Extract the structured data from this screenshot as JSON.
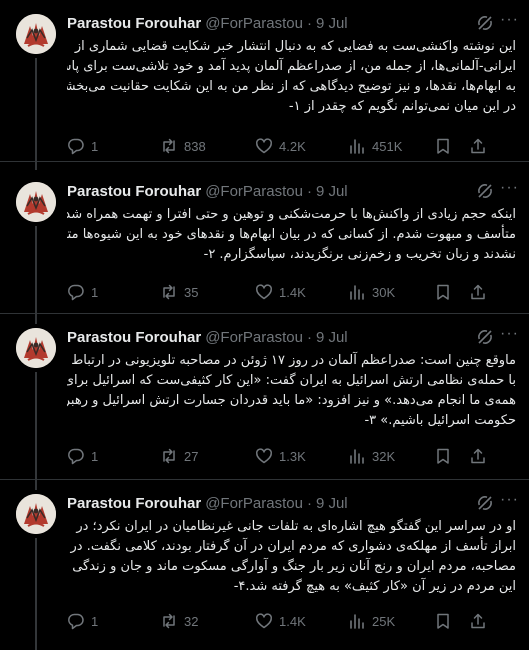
{
  "tweets": [
    {
      "author": "Parastou Forouhar",
      "handle": "@ForParastou",
      "separator": "·",
      "time": "9 Jul",
      "lines": [
        "این نوشته واکنشی‌ست به فضایی که به دنبال انتشار خبر شکایت قضایی شماری از",
        "ایرانی-آلمانی‌ها، از جمله من، از صدراعظم آلمان پدید آمد و خود تلاشی‌ست برای پاسخ",
        "به ابهام‌ها، نقدها، و نیز توضیح دیدگاهی که از نظر من به این شکایت حقانیت می‌بخشد.",
        "در این میان نمی‌توانم نگویم که چقدر از ۱-"
      ],
      "replies": "1",
      "reposts": "838",
      "likes": "4.2K",
      "views": "451K"
    },
    {
      "author": "Parastou Forouhar",
      "handle": "@ForParastou",
      "separator": "·",
      "time": "9 Jul",
      "lines": [
        "اینکه حجم زیادی از واکنش‌ها با حرمت‌شکنی و توهین و حتی افترا و تهمت همراه شده،",
        "متأسف و مبهوت شدم. از کسانی که در بیان ابهام‌ها و نقدهای خود به این شیوه‌ها متوسل",
        "نشدند و زبان تخریب و زخم‌زنی برنگزیدند، سپاسگزارم. ۲-"
      ],
      "replies": "1",
      "reposts": "35",
      "likes": "1.4K",
      "views": "30K"
    },
    {
      "author": "Parastou Forouhar",
      "handle": "@ForParastou",
      "separator": "·",
      "time": "9 Jul",
      "lines": [
        "ماوقع چنین است: صدراعظم آلمان در روز ۱۷ ژوئن در مصاحبه تلویزیونی در ارتباط",
        "با حمله‌ی نظامی ارتش اسرائیل به ایران گفت: «این کار کثیفی‌ست که اسرائیل برای",
        "همه‌ی ما انجام می‌دهد.» و نیز افزود: «ما باید قدردان جسارت ارتش اسرائیل و رهبران",
        "حکومت اسرائیل باشیم.» ۳-"
      ],
      "replies": "1",
      "reposts": "27",
      "likes": "1.3K",
      "views": "32K"
    },
    {
      "author": "Parastou Forouhar",
      "handle": "@ForParastou",
      "separator": "·",
      "time": "9 Jul",
      "lines": [
        "او در سراسر این گفتگو هیچ اشاره‌ای به تلفات جانی غیرنظامیان در ایران نکرد؛ در",
        "ابراز تأسف از مهلکه‌ی دشواری که مردم ایران در آن گرفتار بودند، کلامی نگفت. در",
        "مصاحبه، مردم ایران و رنج آنان زیر بار جنگ و آوارگی مسکوت ماند و جان و زندگی",
        "این مردم در زیر آن «کار کثیف» به هیچ گرفته شد.۴-"
      ],
      "replies": "1",
      "reposts": "32",
      "likes": "1.4K",
      "views": "25K"
    }
  ],
  "icons": {
    "avatar": "avatar-illustration",
    "grok": "grok-icon",
    "more": "more-icon",
    "reply": "reply-icon",
    "repost": "repost-icon",
    "like": "like-icon",
    "views": "views-icon",
    "bookmark": "bookmark-icon",
    "share": "share-icon"
  },
  "colors": {
    "background": "#000000",
    "text": "#e7e9ea",
    "muted": "#71767b",
    "divider": "#2f3336",
    "avatar_bg": "#e9e4dc",
    "avatar_accent": "#b23a2e"
  },
  "more_glyph": "···"
}
